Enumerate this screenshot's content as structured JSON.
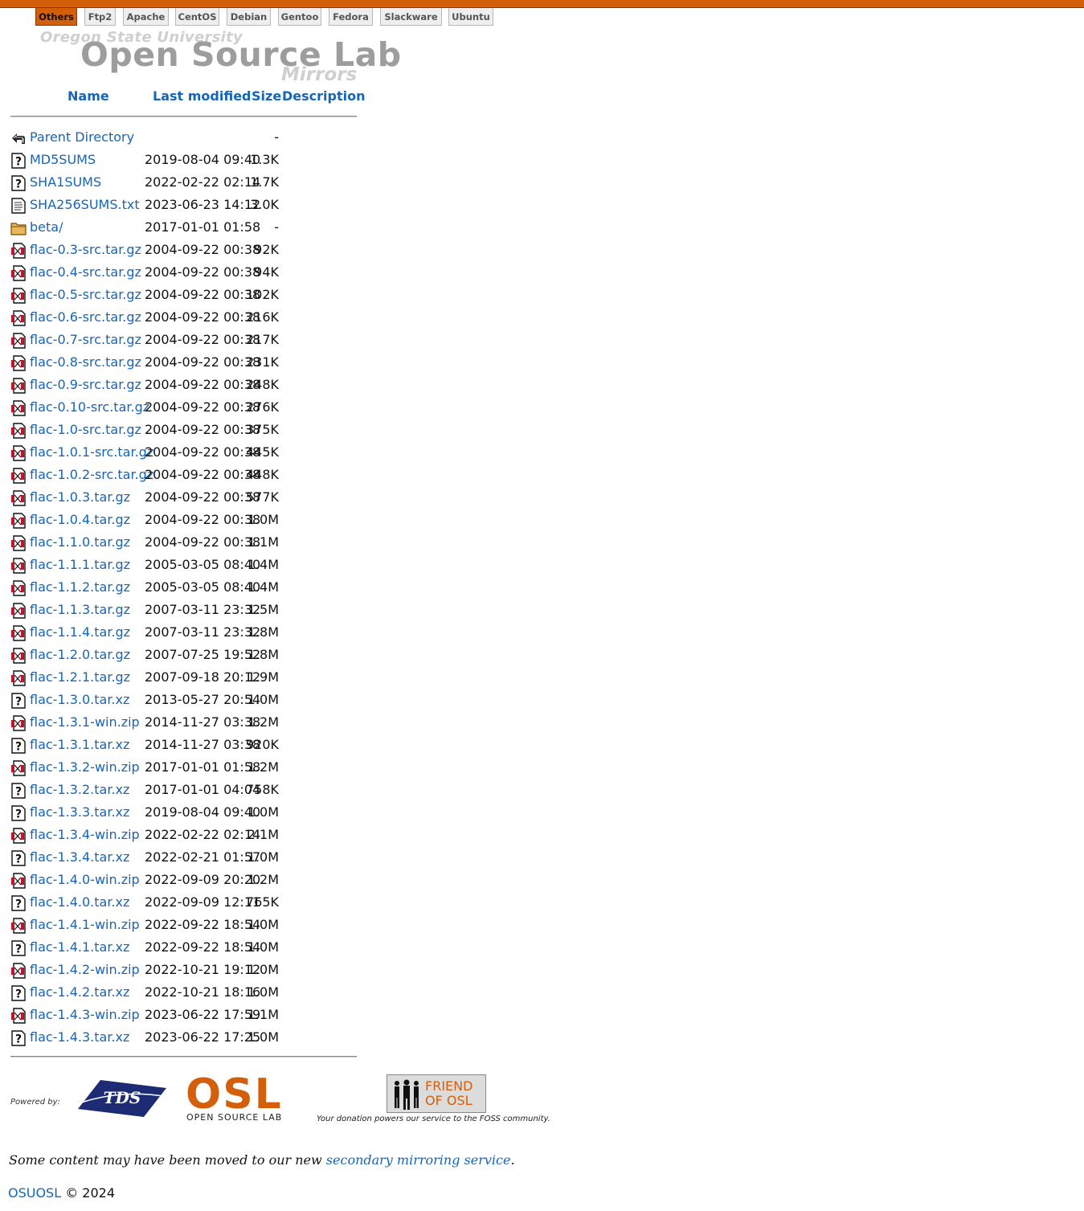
{
  "tabs": [
    {
      "label": "Others",
      "active": true
    },
    {
      "label": "Ftp2",
      "active": false
    },
    {
      "label": "Apache",
      "active": false
    },
    {
      "label": "CentOS",
      "active": false
    },
    {
      "label": "Debian",
      "active": false
    },
    {
      "label": "Gentoo",
      "active": false
    },
    {
      "label": "Fedora",
      "active": false
    },
    {
      "label": "Slackware",
      "active": false
    },
    {
      "label": "Ubuntu",
      "active": false
    }
  ],
  "logo": {
    "university": "Oregon State University",
    "lab": "Open Source Lab",
    "mirrors": "Mirrors"
  },
  "table": {
    "headers": {
      "name": "Name",
      "modified": "Last modified",
      "size": "Size",
      "description": "Description"
    },
    "rows": [
      {
        "icon": "back-icon",
        "name": "Parent Directory",
        "date": "",
        "size": "-"
      },
      {
        "icon": "unknown-file-icon",
        "name": "MD5SUMS",
        "date": "2019-08-04 09:40",
        "size": "1.3K"
      },
      {
        "icon": "unknown-file-icon",
        "name": "SHA1SUMS",
        "date": "2022-02-22 02:14",
        "size": "1.7K"
      },
      {
        "icon": "text-file-icon",
        "name": "SHA256SUMS.txt",
        "date": "2023-06-23 14:12",
        "size": "3.0K"
      },
      {
        "icon": "folder-icon",
        "name": "beta/",
        "date": "2017-01-01 01:58",
        "size": "-"
      },
      {
        "icon": "archive-icon",
        "name": "flac-0.3-src.tar.gz",
        "date": "2004-09-22 00:38",
        "size": "92K"
      },
      {
        "icon": "archive-icon",
        "name": "flac-0.4-src.tar.gz",
        "date": "2004-09-22 00:38",
        "size": "94K"
      },
      {
        "icon": "archive-icon",
        "name": "flac-0.5-src.tar.gz",
        "date": "2004-09-22 00:38",
        "size": "102K"
      },
      {
        "icon": "archive-icon",
        "name": "flac-0.6-src.tar.gz",
        "date": "2004-09-22 00:38",
        "size": "216K"
      },
      {
        "icon": "archive-icon",
        "name": "flac-0.7-src.tar.gz",
        "date": "2004-09-22 00:38",
        "size": "217K"
      },
      {
        "icon": "archive-icon",
        "name": "flac-0.8-src.tar.gz",
        "date": "2004-09-22 00:38",
        "size": "231K"
      },
      {
        "icon": "archive-icon",
        "name": "flac-0.9-src.tar.gz",
        "date": "2004-09-22 00:38",
        "size": "248K"
      },
      {
        "icon": "archive-icon",
        "name": "flac-0.10-src.tar.gz",
        "date": "2004-09-22 00:38",
        "size": "276K"
      },
      {
        "icon": "archive-icon",
        "name": "flac-1.0-src.tar.gz",
        "date": "2004-09-22 00:38",
        "size": "375K"
      },
      {
        "icon": "archive-icon",
        "name": "flac-1.0.1-src.tar.gz",
        "date": "2004-09-22 00:38",
        "size": "445K"
      },
      {
        "icon": "archive-icon",
        "name": "flac-1.0.2-src.tar.gz",
        "date": "2004-09-22 00:38",
        "size": "448K"
      },
      {
        "icon": "archive-icon",
        "name": "flac-1.0.3.tar.gz",
        "date": "2004-09-22 00:38",
        "size": "577K"
      },
      {
        "icon": "archive-icon",
        "name": "flac-1.0.4.tar.gz",
        "date": "2004-09-22 00:38",
        "size": "1.0M"
      },
      {
        "icon": "archive-icon",
        "name": "flac-1.1.0.tar.gz",
        "date": "2004-09-22 00:38",
        "size": "1.1M"
      },
      {
        "icon": "archive-icon",
        "name": "flac-1.1.1.tar.gz",
        "date": "2005-03-05 08:40",
        "size": "1.4M"
      },
      {
        "icon": "archive-icon",
        "name": "flac-1.1.2.tar.gz",
        "date": "2005-03-05 08:40",
        "size": "1.4M"
      },
      {
        "icon": "archive-icon",
        "name": "flac-1.1.3.tar.gz",
        "date": "2007-03-11 23:32",
        "size": "1.5M"
      },
      {
        "icon": "archive-icon",
        "name": "flac-1.1.4.tar.gz",
        "date": "2007-03-11 23:32",
        "size": "1.8M"
      },
      {
        "icon": "archive-icon",
        "name": "flac-1.2.0.tar.gz",
        "date": "2007-07-25 19:52",
        "size": "1.8M"
      },
      {
        "icon": "archive-icon",
        "name": "flac-1.2.1.tar.gz",
        "date": "2007-09-18 20:12",
        "size": "1.9M"
      },
      {
        "icon": "unknown-file-icon",
        "name": "flac-1.3.0.tar.xz",
        "date": "2013-05-27 20:54",
        "size": "1.0M"
      },
      {
        "icon": "archive-icon",
        "name": "flac-1.3.1-win.zip",
        "date": "2014-11-27 03:38",
        "size": "1.2M"
      },
      {
        "icon": "unknown-file-icon",
        "name": "flac-1.3.1.tar.xz",
        "date": "2014-11-27 03:38",
        "size": "920K"
      },
      {
        "icon": "archive-icon",
        "name": "flac-1.3.2-win.zip",
        "date": "2017-01-01 01:58",
        "size": "1.2M"
      },
      {
        "icon": "unknown-file-icon",
        "name": "flac-1.3.2.tar.xz",
        "date": "2017-01-01 04:04",
        "size": "758K"
      },
      {
        "icon": "unknown-file-icon",
        "name": "flac-1.3.3.tar.xz",
        "date": "2019-08-04 09:40",
        "size": "1.0M"
      },
      {
        "icon": "archive-icon",
        "name": "flac-1.3.4-win.zip",
        "date": "2022-02-22 02:14",
        "size": "2.1M"
      },
      {
        "icon": "unknown-file-icon",
        "name": "flac-1.3.4.tar.xz",
        "date": "2022-02-21 01:57",
        "size": "1.0M"
      },
      {
        "icon": "archive-icon",
        "name": "flac-1.4.0-win.zip",
        "date": "2022-09-09 20:20",
        "size": "1.2M"
      },
      {
        "icon": "unknown-file-icon",
        "name": "flac-1.4.0.tar.xz",
        "date": "2022-09-09 12:11",
        "size": "765K"
      },
      {
        "icon": "archive-icon",
        "name": "flac-1.4.1-win.zip",
        "date": "2022-09-22 18:54",
        "size": "1.0M"
      },
      {
        "icon": "unknown-file-icon",
        "name": "flac-1.4.1.tar.xz",
        "date": "2022-09-22 18:54",
        "size": "1.0M"
      },
      {
        "icon": "archive-icon",
        "name": "flac-1.4.2-win.zip",
        "date": "2022-10-21 19:12",
        "size": "1.0M"
      },
      {
        "icon": "unknown-file-icon",
        "name": "flac-1.4.2.tar.xz",
        "date": "2022-10-21 18:16",
        "size": "1.0M"
      },
      {
        "icon": "archive-icon",
        "name": "flac-1.4.3-win.zip",
        "date": "2023-06-22 17:59",
        "size": "1.1M"
      },
      {
        "icon": "unknown-file-icon",
        "name": "flac-1.4.3.tar.xz",
        "date": "2023-06-22 17:25",
        "size": "1.0M"
      }
    ]
  },
  "footer": {
    "powered_by": "Powered by:",
    "tds_logo": "TDS",
    "osl_logo": "OSL",
    "osl_subtitle": "OPEN SOURCE LAB",
    "friend_line1": "FRIEND",
    "friend_line2": "OF OSL",
    "donation": "Your donation powers our service to the FOSS community.",
    "note_prefix": "Some content may have been moved to our new ",
    "note_link": "secondary mirroring service",
    "note_suffix": ".",
    "osuosl_link": "OSUOSL",
    "copyright": " © 2024"
  },
  "colors": {
    "accent": "#d35f0a",
    "link": "#1565b8"
  }
}
